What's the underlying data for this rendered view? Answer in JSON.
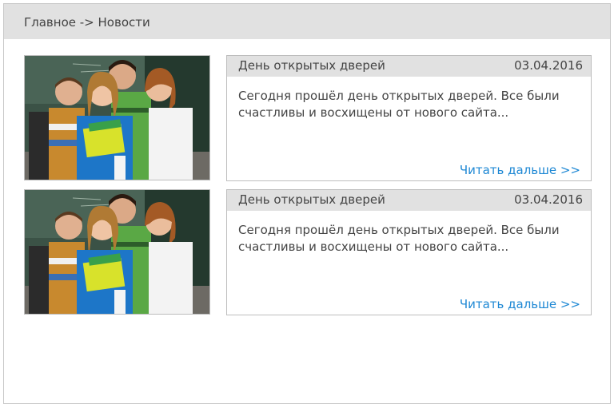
{
  "breadcrumb": {
    "home": "Главное",
    "separator": "->",
    "current": "Новости"
  },
  "colors": {
    "header_bg": "#e1e1e1",
    "text": "#444444",
    "link": "#1e88d4",
    "border": "#bdbdbd"
  },
  "news": [
    {
      "title": "День открытых дверей",
      "date": "03.04.2016",
      "excerpt": "Сегодня прошёл день открытых дверей. Все были счастливы и восхищены от нового сайта...",
      "read_more": "Читать дальше >>"
    },
    {
      "title": "День открытых дверей",
      "date": "03.04.2016",
      "excerpt": "Сегодня прошёл день открытых дверей. Все были счастливы и восхищены от нового сайта...",
      "read_more": "Читать дальше >>"
    }
  ]
}
